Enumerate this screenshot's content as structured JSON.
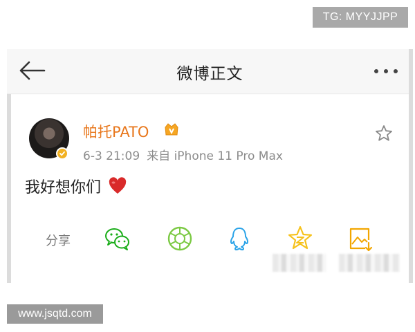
{
  "badge_text": "TG: MYYJJPP",
  "nav": {
    "title": "微博正文"
  },
  "post": {
    "user_name": "帕托PATO",
    "date": "6-3 21:09",
    "source": "来自 iPhone 11 Pro Max",
    "text": "我好想你们"
  },
  "share": {
    "label": "分享",
    "targets": [
      "wechat",
      "wechat-moments",
      "qq",
      "qzone",
      "save-image"
    ]
  },
  "watermark_text": "www.jsqtd.com",
  "colors": {
    "user_name": "#e8771c",
    "verified": "#f2b122",
    "heart": "#d92a2a",
    "wechat": "#1aad19",
    "moments": "#7bc943",
    "qq": "#2aa3e8",
    "qzone": "#f6c21c",
    "save": "#f2a600"
  }
}
